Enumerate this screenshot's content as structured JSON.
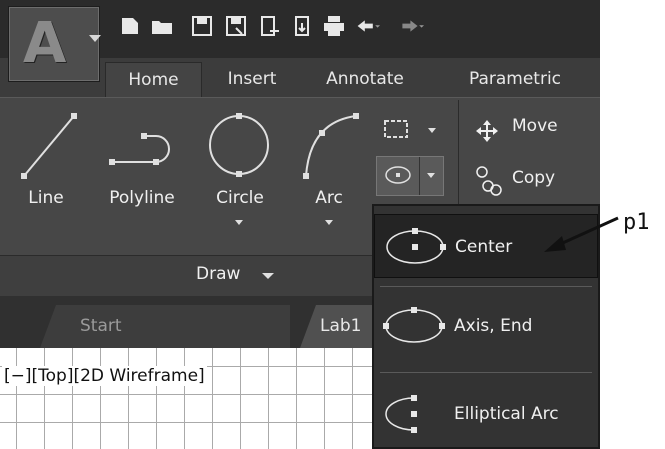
{
  "app": {
    "letter": "A"
  },
  "tabs": [
    {
      "label": "Home",
      "active": true
    },
    {
      "label": "Insert"
    },
    {
      "label": "Annotate"
    },
    {
      "label": "Parametric"
    }
  ],
  "draw_panel": {
    "tools": [
      {
        "label": "Line"
      },
      {
        "label": "Polyline"
      },
      {
        "label": "Circle"
      },
      {
        "label": "Arc"
      }
    ],
    "footer_label": "Draw"
  },
  "modify_panel": {
    "tools": [
      {
        "label": "Move"
      },
      {
        "label": "Copy"
      }
    ]
  },
  "doc_tabs": [
    {
      "label": "Start"
    },
    {
      "label": "Lab1"
    }
  ],
  "viewport_label": "[−][Top][2D Wireframe]",
  "ellipse_menu": {
    "items": [
      {
        "label": "Center"
      },
      {
        "label": "Axis, End"
      },
      {
        "label": "Elliptical Arc"
      }
    ]
  },
  "annotation": {
    "label": "p1"
  },
  "colors": {
    "ribbon_bg": "#474747",
    "menu_bg": "#333333",
    "highlight": "#242424"
  }
}
